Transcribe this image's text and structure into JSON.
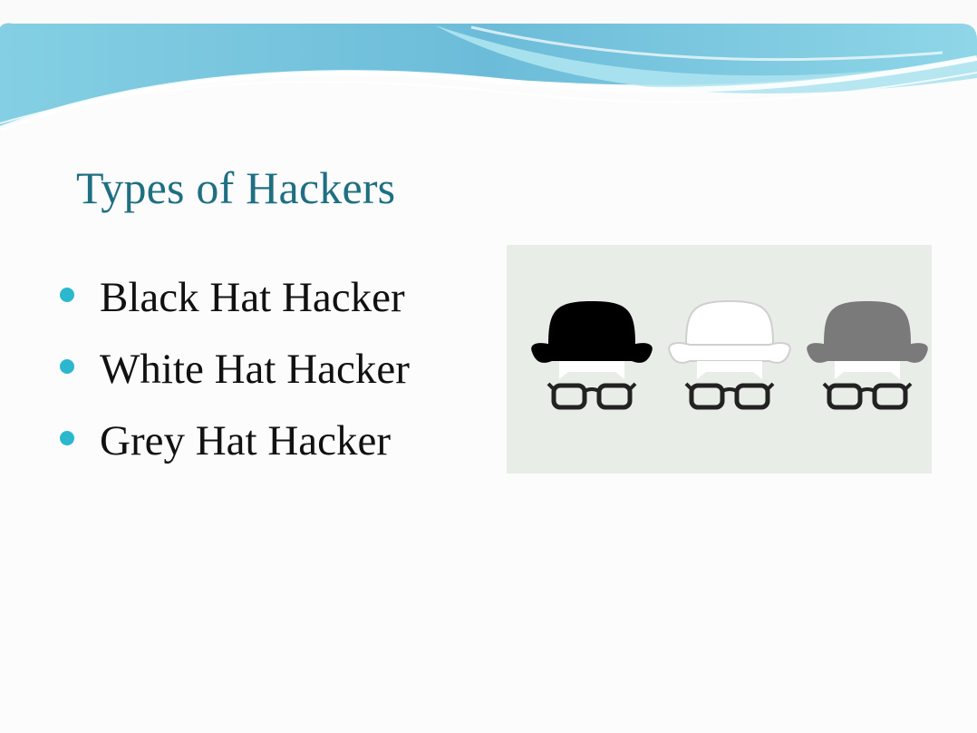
{
  "slide": {
    "title": "Types of Hackers",
    "bullets": [
      {
        "label": "Black Hat Hacker"
      },
      {
        "label": "White Hat Hacker"
      },
      {
        "label": "Grey Hat Hacker"
      }
    ]
  },
  "image": {
    "figures": [
      {
        "icon": "black-hat-icon",
        "hat_color": "#000000"
      },
      {
        "icon": "white-hat-icon",
        "hat_color": "#ffffff"
      },
      {
        "icon": "grey-hat-icon",
        "hat_color": "#7a7a7a"
      }
    ],
    "background_color": "#e9ede8"
  },
  "colors": {
    "title": "#1f6f82",
    "bullet": "#2bb8cf",
    "banner_light": "#a7e2ee",
    "banner_dark": "#5fb4cf"
  }
}
